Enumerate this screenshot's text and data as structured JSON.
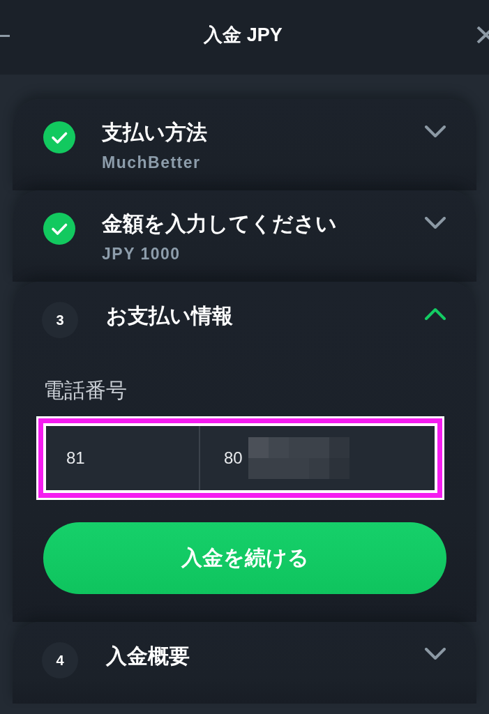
{
  "header": {
    "title": "入金 JPY"
  },
  "steps": [
    {
      "completed": true,
      "title": "支払い方法",
      "summary": "MuchBetter",
      "expanded": false
    },
    {
      "completed": true,
      "title": "金額を入力してください",
      "summary": "JPY 1000",
      "expanded": false
    },
    {
      "completed": false,
      "number": "3",
      "title": "お支払い情報",
      "expanded": true,
      "phone_field": {
        "label": "電話番号",
        "country_code": "81",
        "number": "80",
        "redacted": true,
        "highlighted": true
      },
      "button": {
        "label": "入金を続ける"
      }
    },
    {
      "completed": false,
      "number": "4",
      "title": "入金概要",
      "expanded": false
    }
  ]
}
